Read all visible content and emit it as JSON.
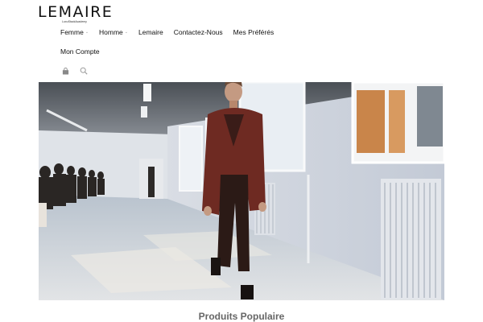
{
  "brand": {
    "name": "LEMAIRE",
    "tagline": "LuxuStackAcademy"
  },
  "nav": {
    "items": [
      {
        "label": "Femme",
        "has_dropdown": true
      },
      {
        "label": "Homme",
        "has_dropdown": true
      },
      {
        "label": "Lemaire",
        "has_dropdown": false
      },
      {
        "label": "Contactez-Nous",
        "has_dropdown": false
      },
      {
        "label": "Mes Préférés",
        "has_dropdown": false
      },
      {
        "label": "Mon Compte",
        "has_dropdown": false
      }
    ],
    "dropdown_glyph": "⌄"
  },
  "tools": {
    "cart_icon": "shopping-bag-icon",
    "search_icon": "search-icon"
  },
  "hero": {
    "subject": "runway-model-photo"
  },
  "sections": {
    "popular_title": "Produits Populaire"
  },
  "colors": {
    "text": "#111111",
    "muted": "#666666",
    "icon": "#888888"
  }
}
